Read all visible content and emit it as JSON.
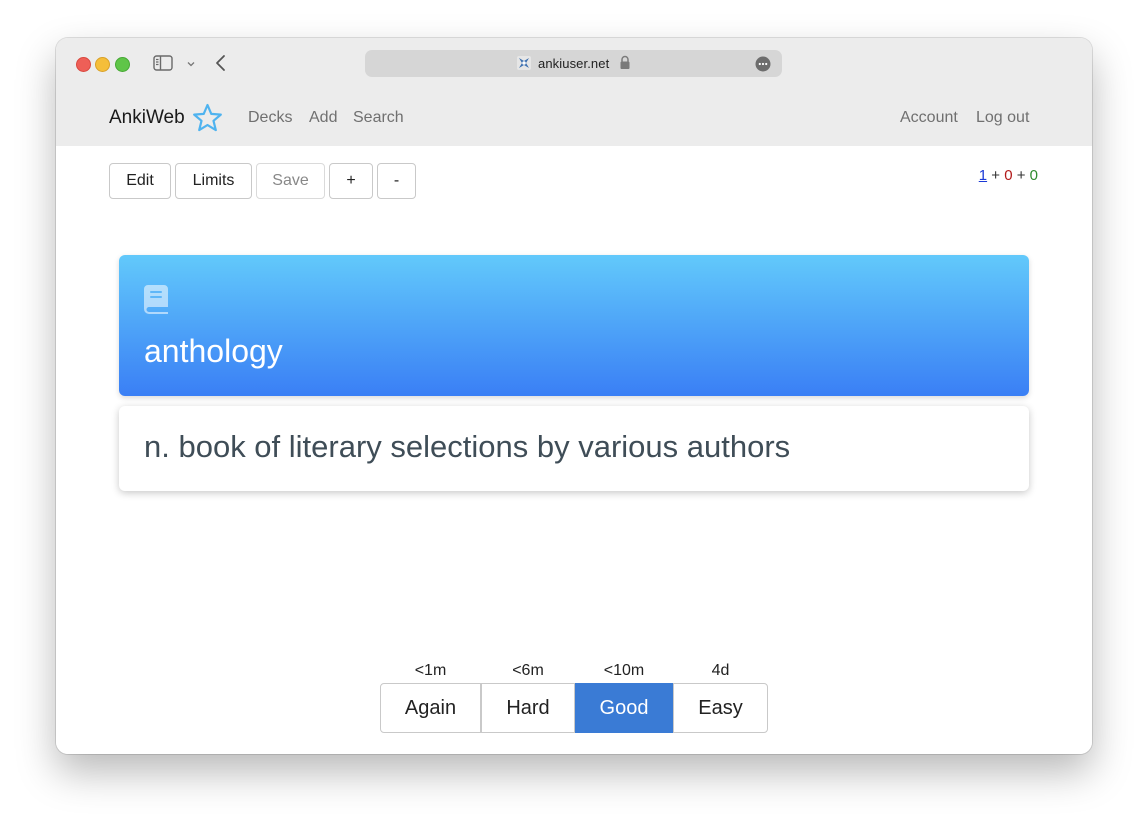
{
  "browser": {
    "url": "ankiuser.net"
  },
  "nav": {
    "brand": "AnkiWeb",
    "links": [
      "Decks",
      "Add",
      "Search"
    ],
    "right_links": [
      "Account",
      "Log out"
    ]
  },
  "toolbar": {
    "edit": "Edit",
    "limits": "Limits",
    "save": "Save",
    "plus": "+",
    "minus": "-"
  },
  "counts": {
    "new": "1",
    "learning": "0",
    "review": "0",
    "separator": "+"
  },
  "card": {
    "front": "anthology",
    "back": "n. book of literary selections by various authors"
  },
  "answer_buttons": [
    {
      "label": "Again",
      "interval": "<1m"
    },
    {
      "label": "Hard",
      "interval": "<6m"
    },
    {
      "label": "Good",
      "interval": "<10m"
    },
    {
      "label": "Easy",
      "interval": "4d"
    }
  ],
  "colors": {
    "accent": "#3a7bd5",
    "new_count": "#1b39d6",
    "learning_count": "#b21a1a",
    "review_count": "#2e8b2e",
    "card_gradient_top": "#62c9fb",
    "card_gradient_bottom": "#3a7ff5"
  }
}
